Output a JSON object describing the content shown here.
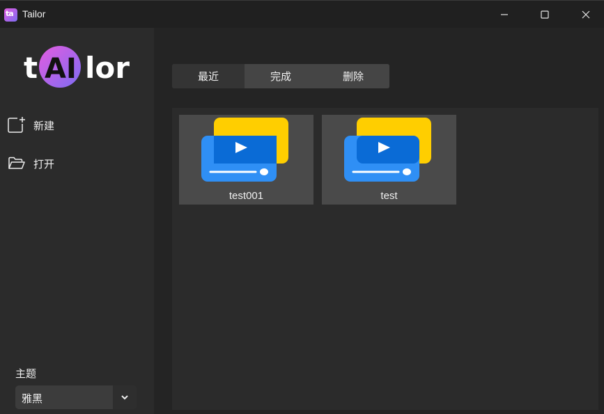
{
  "window": {
    "title": "Tailor"
  },
  "sidebar": {
    "items": [
      {
        "label": "新建",
        "icon": "new-file-icon"
      },
      {
        "label": "打开",
        "icon": "folder-open-icon"
      }
    ],
    "theme": {
      "label": "主题",
      "value": "雅黑"
    }
  },
  "tabs": [
    {
      "label": "最近"
    },
    {
      "label": "完成"
    },
    {
      "label": "删除"
    }
  ],
  "projects": [
    {
      "name": "test001",
      "icon": "video-project-icon"
    },
    {
      "name": "test",
      "icon": "video-project-icon"
    }
  ],
  "colors": {
    "accent_yellow": "#ffce00",
    "accent_blue": "#2f8ff5",
    "logo_gradient_start": "#e45ce0",
    "logo_gradient_end": "#7d6cf2"
  }
}
